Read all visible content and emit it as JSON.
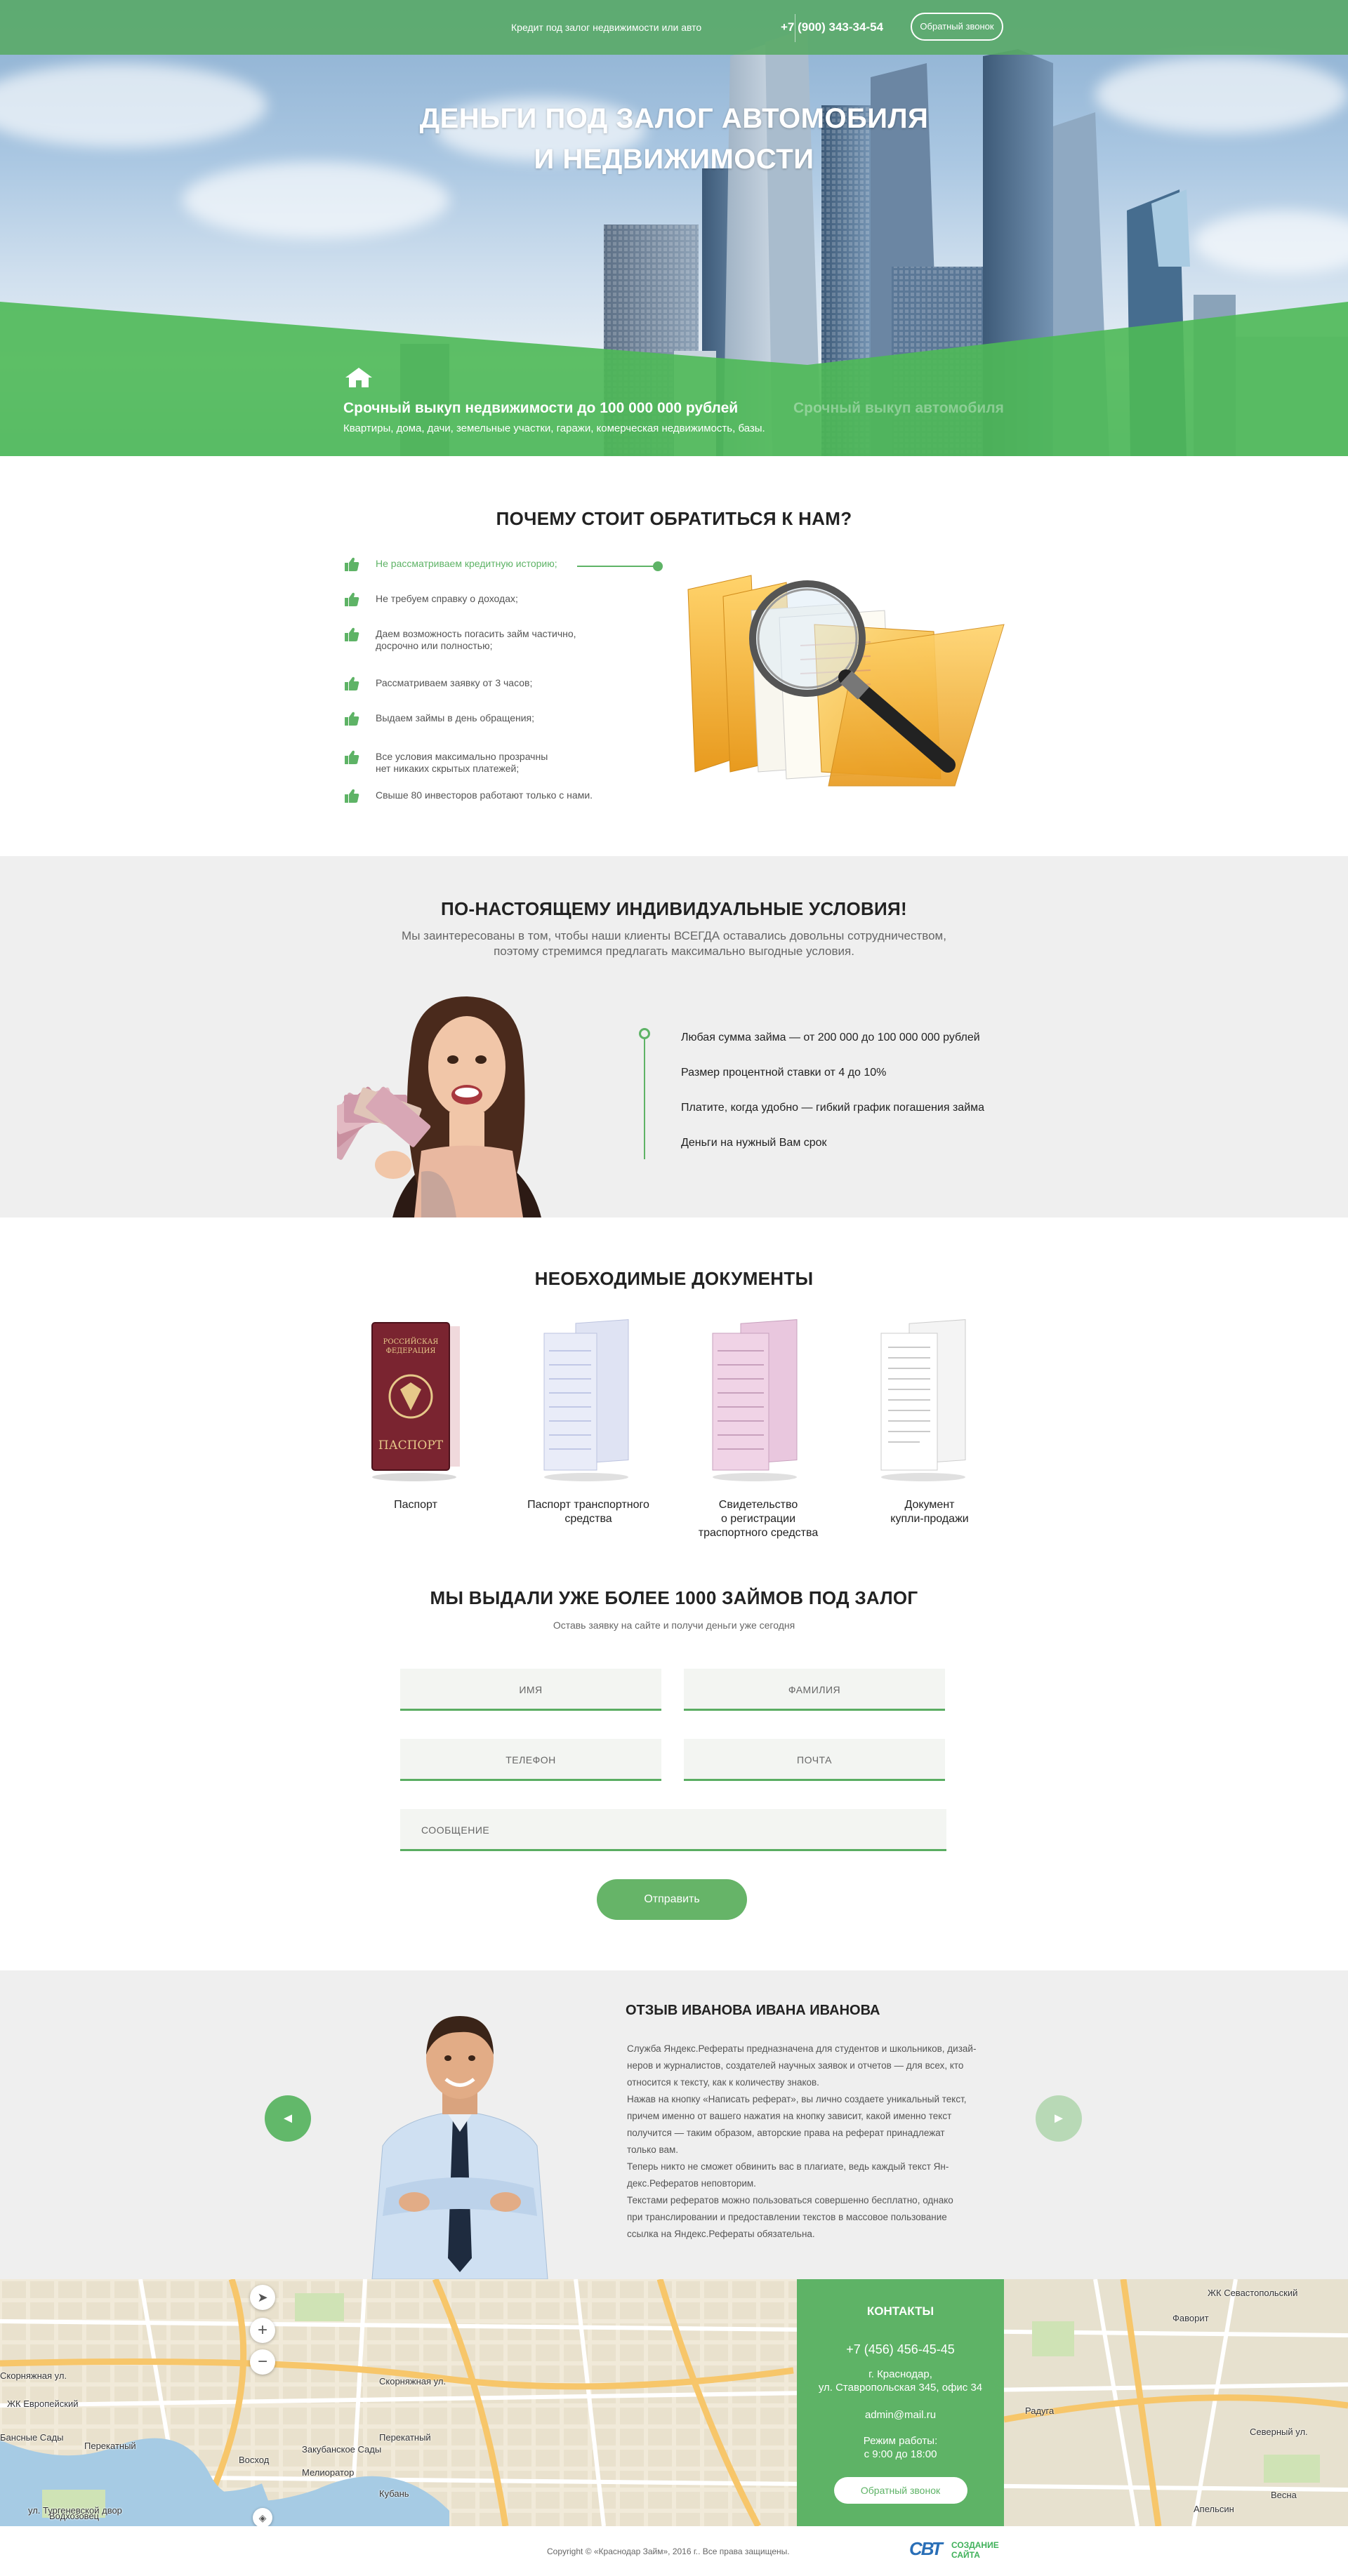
{
  "header": {
    "tagline": "Кредит под залог недвижимости или авто",
    "phone": "+7 (900) 343-34-54",
    "callback_label": "Обратный звонок"
  },
  "hero": {
    "title_line1": "ДЕНЬГИ ПОД ЗАЛОГ АВТОМОБИЛЯ",
    "title_line2": "И НЕДВИЖИМОСТИ",
    "tab1_title": "Срочный выкуп недвижимости до 100 000 000 рублей",
    "tab1_sub": "Квартиры, дома, дачи, земельные участки, гаражи, комерческая недвижимость, базы.",
    "tab2_title": "Срочный выкуп автомобиля",
    "house_icon": "house-icon"
  },
  "why": {
    "title": "ПОЧЕМУ СТОИТ ОБРАТИТЬСЯ К НАМ?",
    "items": [
      {
        "line1": "Не рассматриваем кредитную историю;",
        "line2": ""
      },
      {
        "line1": "Не требуем справку о доходах;",
        "line2": ""
      },
      {
        "line1": "Даем возможность погасить займ частично,",
        "line2": "досрочно или полностью;"
      },
      {
        "line1": "Рассматриваем заявку от 3 часов;",
        "line2": ""
      },
      {
        "line1": "Выдаем займы в день обращения;",
        "line2": ""
      },
      {
        "line1": "Все условия максимально прозрачны",
        "line2": "нет никаких скрытых платежей;"
      },
      {
        "line1": "Свыше 80 инвесторов работают только с нами.",
        "line2": ""
      }
    ]
  },
  "conditions": {
    "title": "ПО-НАСТОЯЩЕМУ ИНДИВИДУАЛЬНЫЕ УСЛОВИЯ!",
    "sub1": "Мы заинтересованы в том, чтобы наши клиенты ВСЕГДА оставались довольны сотрудничеством,",
    "sub2": "поэтому стремимся предлагать максимально выгодные условия.",
    "items": [
      "Любая сумма займа — от 200 000 до 100 000 000 рублей",
      "Размер процентной ставки от 4 до 10%",
      "Платите, когда удобно —  гибкий график погашения займа",
      "Деньги на нужный Вам срок"
    ]
  },
  "documents": {
    "title": "НЕОБХОДИМЫЕ ДОКУМЕНТЫ",
    "passport_cover_line1": "РОССИЙСКАЯ",
    "passport_cover_line2": "ФЕДЕРАЦИЯ",
    "passport_cover_word": "ПАСПОРТ",
    "items": [
      {
        "line1": "Паспорт",
        "line2": "",
        "line3": ""
      },
      {
        "line1": "Паспорт транспортного",
        "line2": "средства",
        "line3": ""
      },
      {
        "line1": "Свидетельство",
        "line2": "о регистрации",
        "line3": "траспортного средства"
      },
      {
        "line1": "Документ",
        "line2": "купли-продажи",
        "line3": ""
      }
    ]
  },
  "form": {
    "title": "МЫ ВЫДАЛИ УЖЕ БОЛЕЕ 1000 ЗАЙМОВ ПОД ЗАЛОГ",
    "subtitle": "Оставь заявку на сайте и получи деньги уже сегодня",
    "name": "ИМЯ",
    "surname": "ФАМИЛИЯ",
    "phone": "ТЕЛЕФОН",
    "email": "ПОЧТА",
    "message": "СООБЩЕНИЕ",
    "submit": "Отправить"
  },
  "review": {
    "title": "ОТЗЫВ ИВАНОВА ИВАНА ИВАНОВА",
    "lines": [
      "Служба Яндекс.Рефераты предназначена для студентов и школьников, дизай-",
      "неров и журналистов, создателей научных заявок и отчетов — для всех, кто",
      "относится к тексту, как к количеству знаков.",
      "Нажав на кнопку «Написать реферат», вы лично создаете уникальный текст,",
      "причем именно от вашего нажатия на кнопку зависит, какой именно текст",
      "получится — таким образом, авторские права на реферат принадлежат",
      "только вам.",
      "Теперь никто не сможет обвинить вас в плагиате, ведь каждый текст Ян-",
      "декс.Рефератов неповторим.",
      "Текстами рефератов можно пользоваться совершенно бесплатно, однако",
      "при транслировании и предоставлении текстов в массовое пользование",
      "ссылка на Яндекс.Рефераты обязательна."
    ],
    "prev": "◄",
    "next": "►"
  },
  "map": {
    "labels": [
      "Скорняжная ул.",
      "ЖК Европейский",
      "Бансные Сады",
      "Перекатный",
      "Водхозовец",
      "ул. Тургеневской двор",
      "Восход",
      "Закубанское Сады",
      "Мелиоратор",
      "Кубань",
      "Скорняжная ул.",
      "Перекатный",
      "ЖК Севастопольский",
      "Фаворит",
      "Северный ул.",
      "Радуга",
      "Весна",
      "Апельсин"
    ],
    "zoom_in": "+",
    "zoom_out": "−"
  },
  "contacts": {
    "title": "КОНТАКТЫ",
    "phone": "+7 (456) 456-45-45",
    "city": "г. Краснодар,",
    "address": "ул. Ставропольская 345, офис 34",
    "email": "admin@mail.ru",
    "hours_label": "Режим работы:",
    "hours": "с 9:00 до 18:00",
    "callback": "Обратный звонок"
  },
  "footer": {
    "copyright": "Copyright © «Краснодар Займ», 2016 г.. Все права защищены.",
    "logo_line1": "СОЗДАНИЕ",
    "logo_line2": "САЙТА",
    "logo_mark": "СВТ"
  },
  "colors": {
    "accent": "#5eb366",
    "dark_text": "#222222",
    "bg_grey": "#efefef"
  }
}
